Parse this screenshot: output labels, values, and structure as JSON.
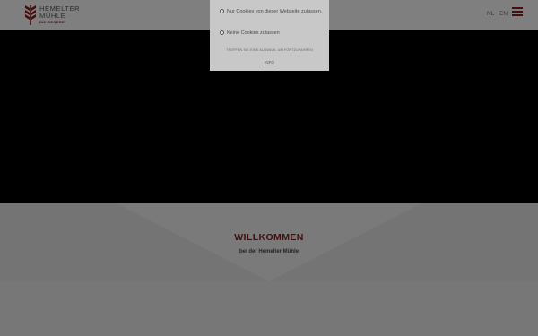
{
  "header": {
    "logo_title_line1": "HEMELTER",
    "logo_title_line2": "MÜHLE",
    "logo_sub": "DIE ZIEGEREI",
    "lang_nl": "NL",
    "lang_en": "EN"
  },
  "welcome": {
    "title": "WILLKOMMEN",
    "subtitle": "bei der Hemelter Mühle"
  },
  "cookie_dialog": {
    "option_site_only": "Nur Cookies von dieser Webseite zulassen.",
    "option_none": "Keine Cookies zulassen",
    "hint": "TREFFEN SIE EINE AUSWAHL UM FORTZUFAHREN",
    "info_link": "INFO"
  },
  "colors": {
    "brand": "#8b1a1a",
    "overlay": "rgba(0,0,0,0.5)"
  },
  "icons": {
    "logo": "wheat-logo-icon",
    "menu": "hamburger-menu-icon"
  }
}
